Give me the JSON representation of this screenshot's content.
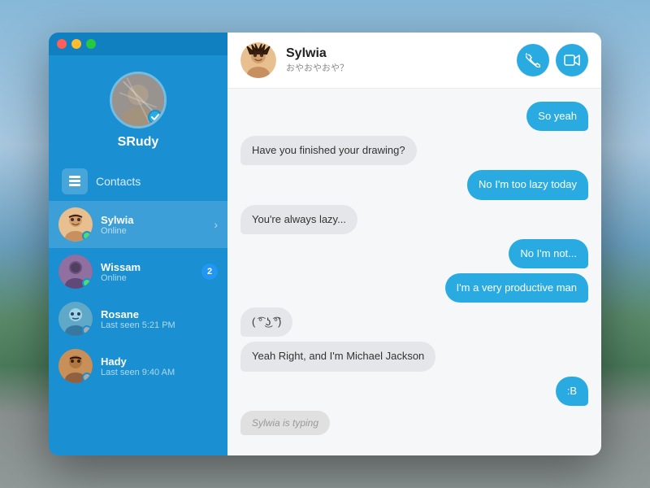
{
  "window": {
    "controls": [
      "close",
      "minimize",
      "maximize"
    ]
  },
  "sidebar": {
    "user": {
      "name": "SRudy",
      "verified": true
    },
    "contacts_label": "Contacts",
    "contacts": [
      {
        "id": "sylwia",
        "name": "Sylwia",
        "status": "Online",
        "status_type": "online",
        "active": true,
        "badge": null,
        "has_chevron": true
      },
      {
        "id": "wissam",
        "name": "Wissam",
        "status": "Online",
        "status_type": "online",
        "active": false,
        "badge": "2",
        "has_chevron": false
      },
      {
        "id": "rosane",
        "name": "Rosane",
        "status": "Last seen 5:21 PM",
        "status_type": "offline",
        "active": false,
        "badge": null,
        "has_chevron": false
      },
      {
        "id": "hady",
        "name": "Hady",
        "status": "Last seen 9:40 AM",
        "status_type": "offline",
        "active": false,
        "badge": null,
        "has_chevron": false
      }
    ]
  },
  "chat": {
    "contact_name": "Sylwia",
    "contact_sub": "おやおやおや？",
    "messages": [
      {
        "id": 1,
        "type": "sent",
        "text": "So yeah"
      },
      {
        "id": 2,
        "type": "received",
        "text": "Have you finished your drawing?"
      },
      {
        "id": 3,
        "type": "sent",
        "text": "No I'm too lazy today"
      },
      {
        "id": 4,
        "type": "received",
        "text": "You're always lazy..."
      },
      {
        "id": 5,
        "type": "sent",
        "text": "No I'm not..."
      },
      {
        "id": 6,
        "type": "sent",
        "text": "I'm a very productive man"
      },
      {
        "id": 7,
        "type": "received",
        "text": "( ͡° ͜ʖ ͡°)"
      },
      {
        "id": 8,
        "type": "received",
        "text": "Yeah Right, and I'm Michael Jackson"
      },
      {
        "id": 9,
        "type": "sent",
        "text": ":B"
      }
    ],
    "typing_indicator": "Sylwia is typing",
    "phone_btn_label": "call",
    "video_btn_label": "video"
  }
}
